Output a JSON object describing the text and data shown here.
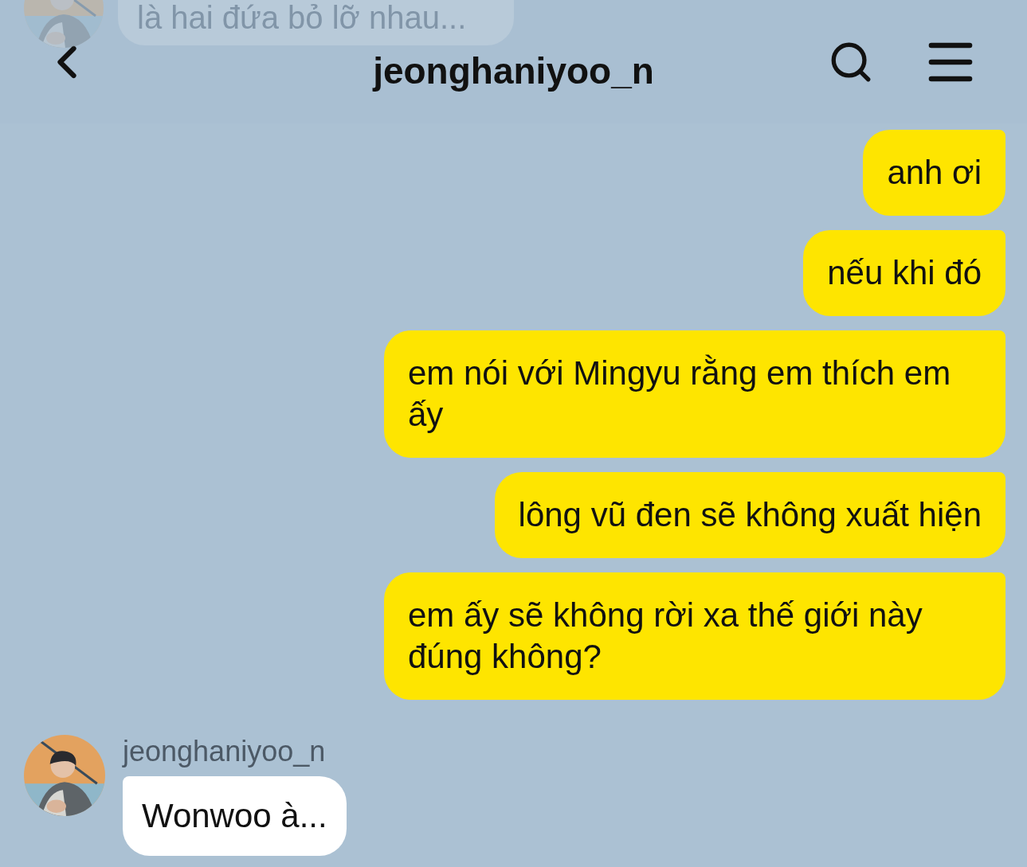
{
  "header": {
    "title": "jeonghaniyoo_n"
  },
  "previous_message": {
    "text": "là hai đứa bỏ lỡ nhau..."
  },
  "messages": [
    {
      "kind": "sent",
      "text": "anh ơi"
    },
    {
      "kind": "sent",
      "text": "nếu khi đó"
    },
    {
      "kind": "sent",
      "text": "em nói với Mingyu rằng em thích em ấy"
    },
    {
      "kind": "sent",
      "text": "lông vũ đen sẽ không xuất hiện"
    },
    {
      "kind": "sent",
      "text": "em ấy sẽ không rời xa thế giới này đúng không?"
    },
    {
      "kind": "received",
      "sender": "jeonghaniyoo_n",
      "text": "Wonwoo à..."
    }
  ]
}
